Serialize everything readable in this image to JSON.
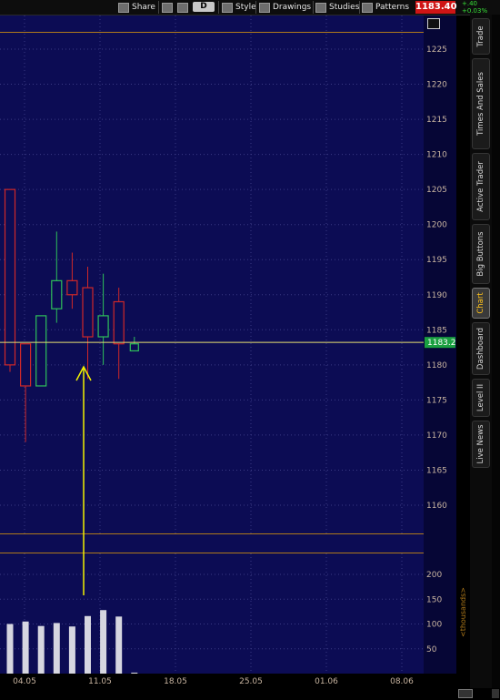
{
  "toolbar": {
    "share": "Share",
    "period": "D",
    "style": "Style",
    "drawings": "Drawings",
    "studies": "Studies",
    "patterns": "Patterns",
    "last_price": "1183.40",
    "change_abs": "+.40",
    "change_pct": "+0.03%"
  },
  "price_axis": {
    "ticks": [
      "1225",
      "1220",
      "1215",
      "1210",
      "1205",
      "1200",
      "1195",
      "1190",
      "1185",
      "1180",
      "1175",
      "1170",
      "1165",
      "1160"
    ],
    "current_label": "1183.2"
  },
  "volume_axis": {
    "ticks": [
      "200",
      "150",
      "100",
      "50"
    ],
    "unit_label": "<thousands>"
  },
  "x_axis": {
    "ticks": [
      "04.05",
      "11.05",
      "18.05",
      "25.05",
      "01.06",
      "08.06"
    ]
  },
  "sidebar": {
    "tabs": [
      "Trade",
      "Times And Sales",
      "Active Trader",
      "Big Buttons",
      "Chart",
      "Dashboard",
      "Level II",
      "Live News"
    ],
    "active": "Chart"
  },
  "chart_data": {
    "type": "candlestick",
    "x_ticks": [
      "04.05",
      "11.05",
      "18.05",
      "25.05",
      "01.06",
      "08.06"
    ],
    "ylim": [
      1155,
      1228
    ],
    "current_price": 1183.2,
    "candles": [
      {
        "open": 1205,
        "high": 1205,
        "low": 1179,
        "close": 1180,
        "color": "red"
      },
      {
        "open": 1183,
        "high": 1183,
        "low": 1169,
        "close": 1177,
        "color": "red"
      },
      {
        "open": 1177,
        "high": 1187,
        "low": 1177,
        "close": 1187,
        "color": "green"
      },
      {
        "open": 1188,
        "high": 1199,
        "low": 1186,
        "close": 1192,
        "color": "green"
      },
      {
        "open": 1192,
        "high": 1196,
        "low": 1188,
        "close": 1190,
        "color": "red"
      },
      {
        "open": 1191,
        "high": 1194,
        "low": 1178,
        "close": 1184,
        "color": "red"
      },
      {
        "open": 1184,
        "high": 1193,
        "low": 1180,
        "close": 1187,
        "color": "green"
      },
      {
        "open": 1189,
        "high": 1191,
        "low": 1178,
        "close": 1183,
        "color": "red"
      },
      {
        "open": 1182,
        "high": 1184,
        "low": 1182,
        "close": 1183,
        "color": "green"
      }
    ],
    "volume": [
      100,
      105,
      96,
      102,
      95,
      116,
      128,
      115,
      2
    ]
  },
  "colors": {
    "background": "#0c0c54",
    "grid": "#3a3a84",
    "up": "#2fc05a",
    "down": "#d02828",
    "pane_border": "#b07a1a",
    "current_price_line": "#e8e070",
    "annotation_arrow": "#f2f200",
    "volume_bar": "#d6d6e0",
    "axis_text": "#c8b4a0"
  }
}
